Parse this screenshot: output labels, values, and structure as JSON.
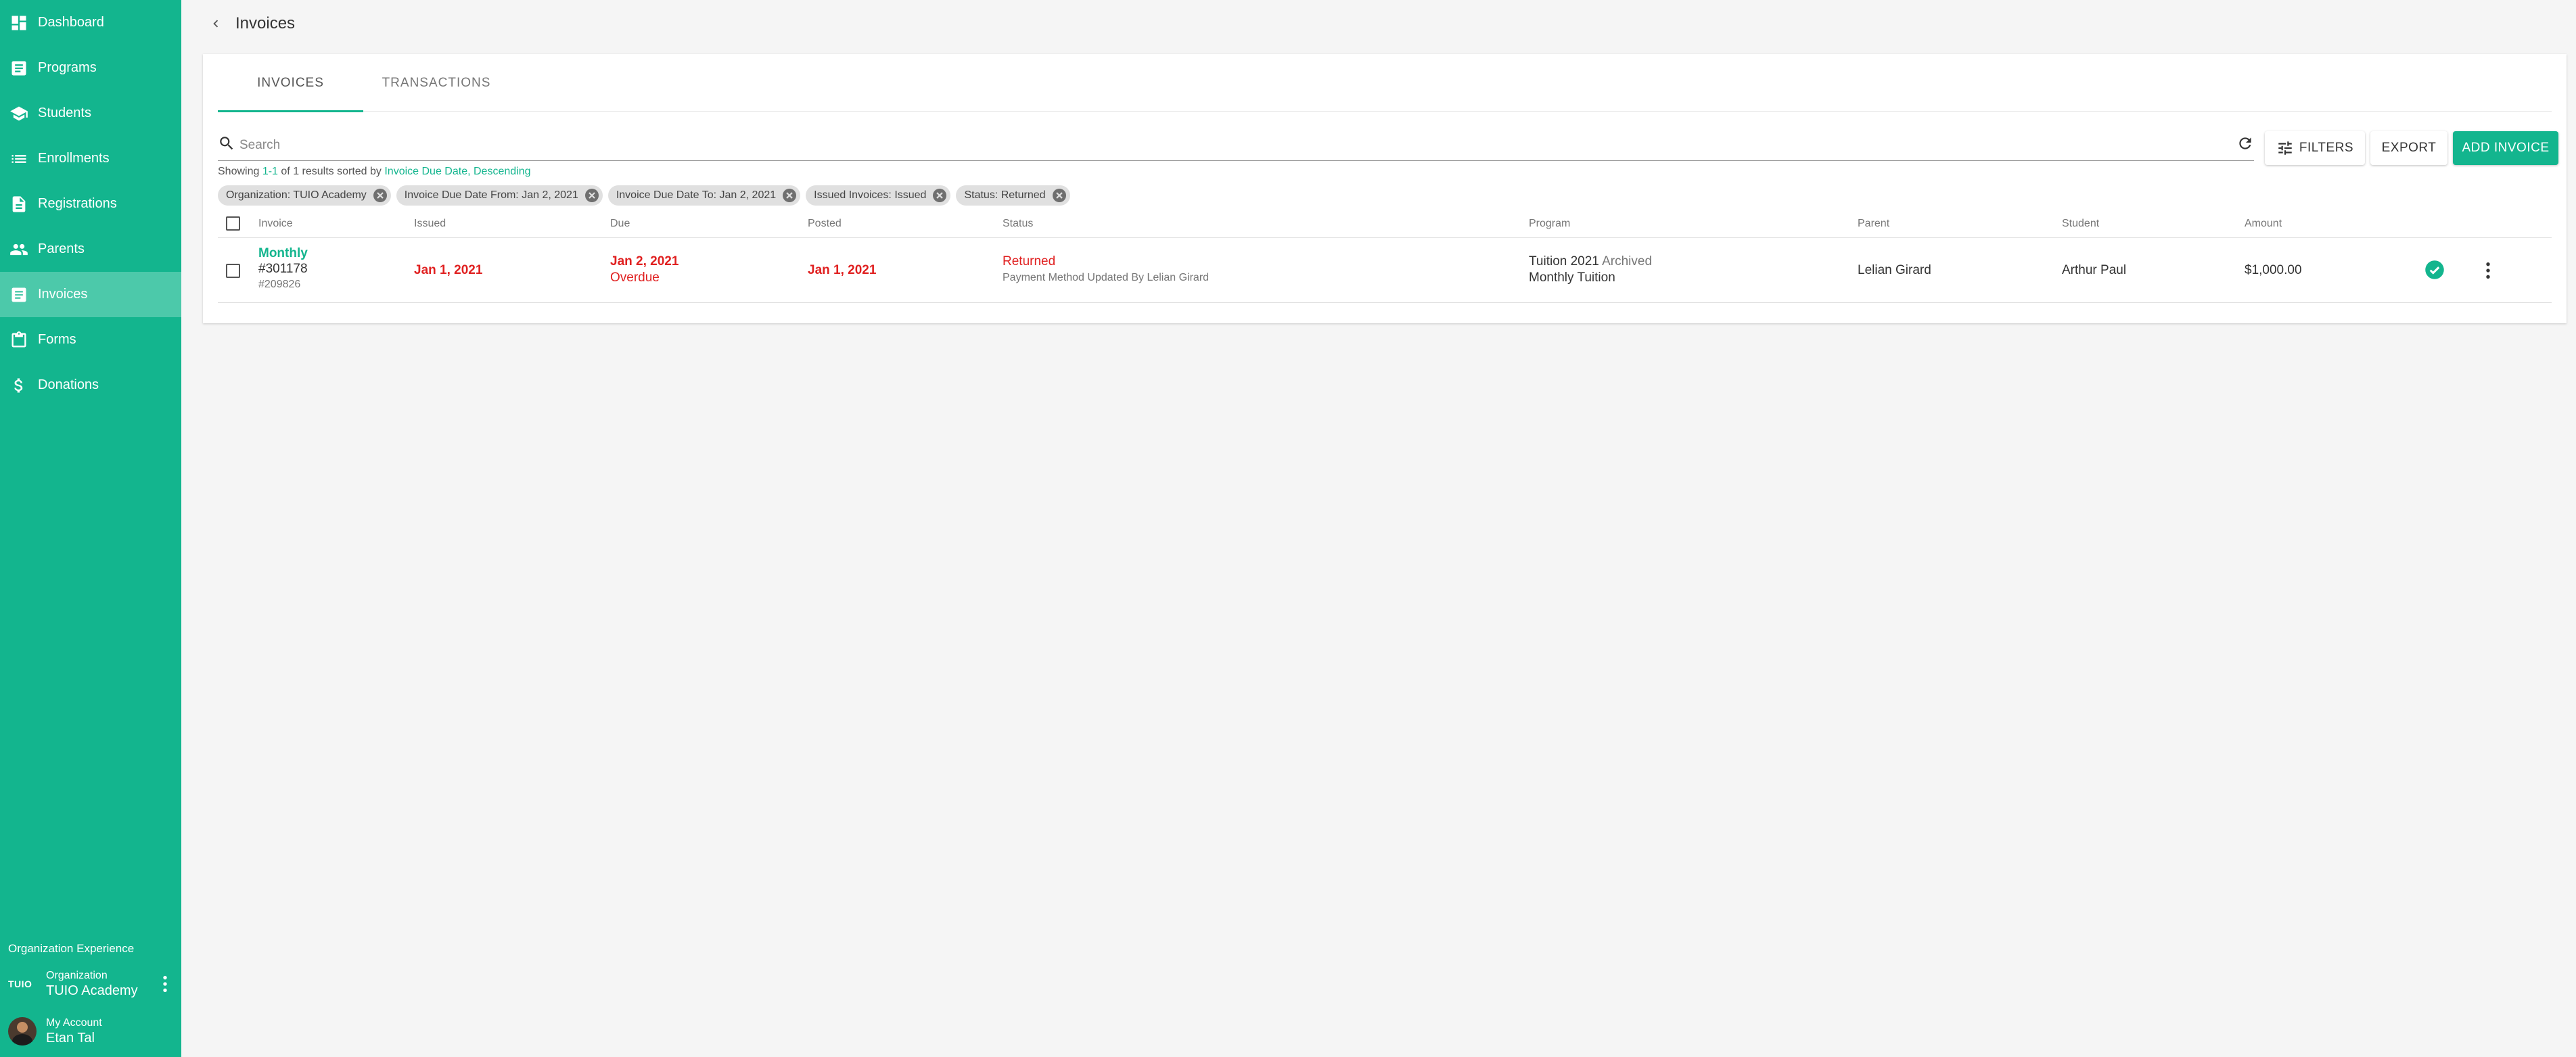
{
  "sidebar": {
    "items": [
      {
        "label": "Dashboard",
        "icon": "dashboard-icon"
      },
      {
        "label": "Programs",
        "icon": "document-icon"
      },
      {
        "label": "Students",
        "icon": "school-icon"
      },
      {
        "label": "Enrollments",
        "icon": "list-icon"
      },
      {
        "label": "Registrations",
        "icon": "document-icon"
      },
      {
        "label": "Parents",
        "icon": "people-icon"
      },
      {
        "label": "Invoices",
        "icon": "document-icon",
        "active": true
      },
      {
        "label": "Forms",
        "icon": "clipboard-icon"
      },
      {
        "label": "Donations",
        "icon": "dollar-icon"
      }
    ],
    "org_experience": "Organization Experience",
    "org_mark": "TUIO",
    "org_label": "Organization",
    "org_name": "TUIO Academy",
    "account_label": "My Account",
    "account_name": "Etan Tal"
  },
  "header": {
    "title": "Invoices"
  },
  "tabs": [
    "INVOICES",
    "TRANSACTIONS"
  ],
  "search": {
    "placeholder": "Search"
  },
  "buttons": {
    "filters": "FILTERS",
    "export": "EXPORT",
    "add": "ADD INVOICE"
  },
  "summary": {
    "prefix": "Showing ",
    "range": "1-1",
    "middle": " of 1 results sorted by ",
    "sort": "Invoice Due Date, Descending"
  },
  "chips": [
    "Organization: TUIO Academy",
    "Invoice Due Date From: Jan 2, 2021",
    "Invoice Due Date To: Jan 2, 2021",
    "Issued Invoices: Issued",
    "Status: Returned"
  ],
  "columns": {
    "invoice": "Invoice",
    "issued": "Issued",
    "due": "Due",
    "posted": "Posted",
    "status": "Status",
    "program": "Program",
    "parent": "Parent",
    "student": "Student",
    "amount": "Amount"
  },
  "rows": [
    {
      "invoice_name": "Monthly",
      "invoice_number": "#301178",
      "invoice_sub": "#209826",
      "issued": "Jan 1, 2021",
      "due": "Jan 2, 2021",
      "due_note": "Overdue",
      "posted": "Jan 1, 2021",
      "status": "Returned",
      "status_note": "Payment Method Updated By Lelian Girard",
      "program": "Tuition 2021",
      "program_tag": " Archived",
      "program_sub": "Monthly Tuition",
      "parent": "Lelian Girard",
      "student": "Arthur Paul",
      "amount": "$1,000.00"
    }
  ],
  "colors": {
    "accent": "#13b58e",
    "active_nav": "#4cc9aa",
    "danger": "#e02020"
  }
}
